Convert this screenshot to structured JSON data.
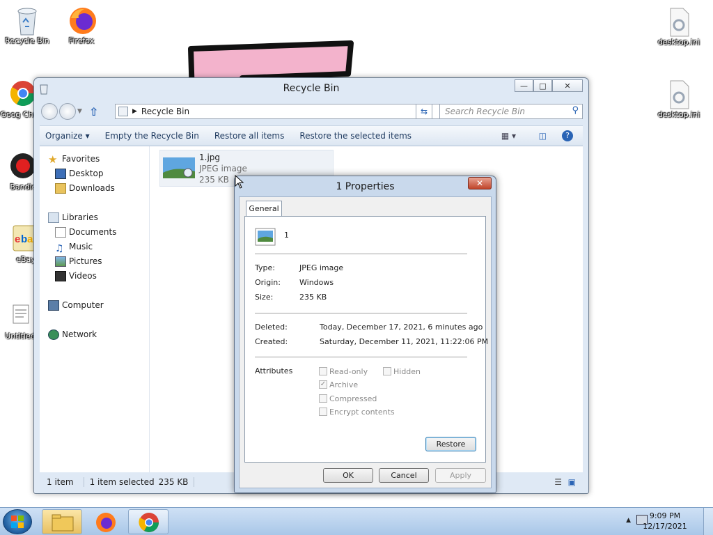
{
  "desktop": {
    "icons": [
      {
        "label": "Recycle Bin",
        "icon": "recycle-bin-icon"
      },
      {
        "label": "Firefox",
        "icon": "firefox-icon"
      },
      {
        "label": "Goog Chron",
        "icon": "chrome-icon"
      },
      {
        "label": "Bandic",
        "icon": "bandicam-icon"
      },
      {
        "label": "eBay",
        "icon": "ebay-icon"
      },
      {
        "label": "Untitled",
        "icon": "document-icon"
      },
      {
        "label": "desktop.ini",
        "icon": "settings-file-icon"
      },
      {
        "label": "desktop.ini",
        "icon": "settings-file-icon"
      }
    ]
  },
  "explorer": {
    "title": "Recycle Bin",
    "address": "Recycle Bin",
    "search_placeholder": "Search Recycle Bin",
    "toolbar": {
      "organize": "Organize",
      "empty": "Empty the Recycle Bin",
      "restore_all": "Restore all items",
      "restore_selected": "Restore the selected items"
    },
    "nav": {
      "favorites": "Favorites",
      "desktop": "Desktop",
      "downloads": "Downloads",
      "libraries": "Libraries",
      "documents": "Documents",
      "music": "Music",
      "pictures": "Pictures",
      "videos": "Videos",
      "computer": "Computer",
      "network": "Network"
    },
    "file": {
      "name": "1.jpg",
      "type": "JPEG image",
      "size": "235 KB"
    },
    "status": {
      "count": "1 item",
      "selected": "1 item selected",
      "size": "235 KB"
    }
  },
  "properties": {
    "title": "1 Properties",
    "tab": "General",
    "name": "1",
    "rows": {
      "type_label": "Type:",
      "type_value": "JPEG image",
      "origin_label": "Origin:",
      "origin_value": "Windows",
      "size_label": "Size:",
      "size_value": "235 KB",
      "deleted_label": "Deleted:",
      "deleted_value": "Today, December 17, 2021, 6 minutes ago",
      "created_label": "Created:",
      "created_value": "Saturday, December 11, 2021, 11:22:06 PM",
      "attributes_label": "Attributes"
    },
    "attributes": {
      "readonly": "Read-only",
      "hidden": "Hidden",
      "archive": "Archive",
      "compressed": "Compressed",
      "encrypt": "Encrypt contents"
    },
    "buttons": {
      "restore": "Restore",
      "ok": "OK",
      "cancel": "Cancel",
      "apply": "Apply"
    }
  },
  "taskbar": {
    "time": "9:09 PM",
    "date": "12/17/2021"
  }
}
